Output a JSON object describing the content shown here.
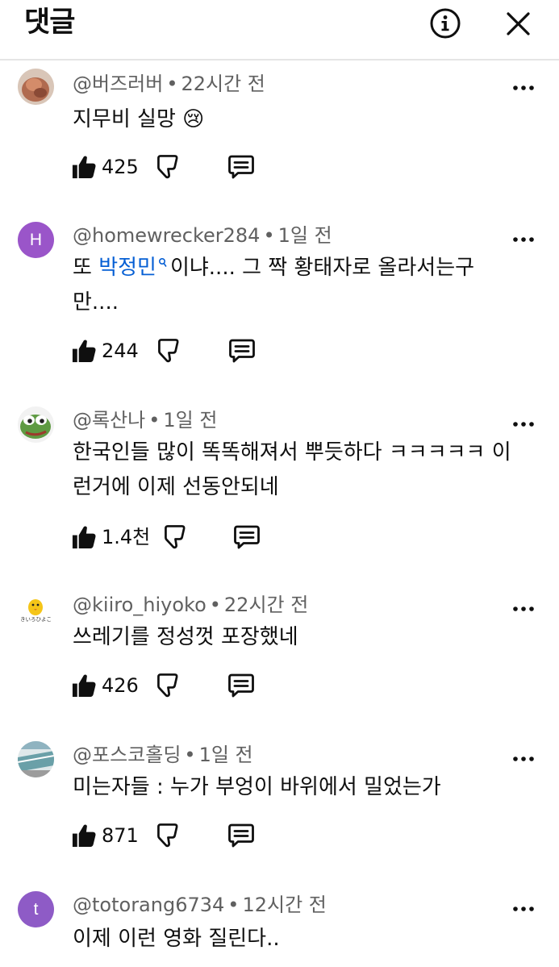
{
  "header": {
    "title": "댓글",
    "info_icon": "info-circle-icon",
    "close_icon": "close-icon"
  },
  "comments": [
    {
      "author": "@버즈러버",
      "time": "22시간 전",
      "text": "지무비 실망",
      "emoji": "😢",
      "likes": "425",
      "avatar_color": "#c8a48a"
    },
    {
      "author": "@homewrecker284",
      "time": "1일 전",
      "text_before": "또 ",
      "mention": "박정민",
      "text_after": "이냐.... 그 짝 황태자로 올라서는구만....",
      "likes": "244",
      "avatar_letter": "H",
      "avatar_color": "#9a55c9"
    },
    {
      "author": "@록산나",
      "time": "1일 전",
      "text": "한국인들 많이 똑똑해져서 뿌듯하다 ㅋㅋㅋㅋㅋ 이런거에 이제 선동안되네",
      "likes": "1.4천",
      "avatar_color": "#4f8a3c"
    },
    {
      "author": "@kiiro_hiyoko",
      "time": "22시간 전",
      "text": "쓰레기를 정성껏 포장했네",
      "likes": "426",
      "avatar_caption": "きいろひよこ",
      "avatar_color": "#f5c518"
    },
    {
      "author": "@포스코홀딩",
      "time": "1일 전",
      "text": "미는자들 : 누가 부엉이 바위에서 밀었는가",
      "likes": "871",
      "avatar_color": "#6aa0a8"
    },
    {
      "author": "@totorang6734",
      "time": "12시간 전",
      "text": "이제 이런 영화 질린다..",
      "avatar_letter": "t",
      "avatar_color": "#8e5bc6"
    }
  ],
  "colors": {
    "meta": "#606060",
    "text": "#0f0f0f",
    "mention": "#065fd4",
    "divider": "#e5e5e5"
  }
}
